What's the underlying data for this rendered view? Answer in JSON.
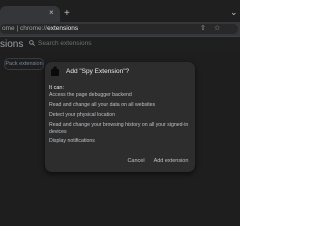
{
  "tabstrip": {
    "close_glyph": "×",
    "new_tab_glyph": "+",
    "tab_search_glyph": "⌄"
  },
  "toolbar": {
    "url_scheme": "ome",
    "url_separator": "|",
    "url_prefix": "chrome://",
    "url_path": "extensions",
    "share_glyph": "⇧",
    "star_glyph": "☆"
  },
  "page": {
    "title": "sions",
    "search_placeholder": "Search extensions",
    "pack_button_label": "Pack extension"
  },
  "dialog": {
    "title": "Add \"Spy Extension\"?",
    "it_can_label": "It can:",
    "permissions": [
      "Access the page debugger backend",
      "Read and change all your data on all websites",
      "Detect your physical location",
      "Read and change your browsing history on all your signed-in devices",
      "Display notifications"
    ],
    "cancel_label": "Cancel",
    "add_label": "Add extension"
  },
  "colors": {
    "page_background": "#202124",
    "dialog_background": "#2d2d2d",
    "text_primary": "#e8eaed",
    "text_secondary": "#bdc1c6"
  },
  "icons": [
    "close-icon",
    "plus-icon",
    "chevron-down-icon",
    "share-icon",
    "star-icon",
    "search-icon",
    "extension-icon"
  ]
}
